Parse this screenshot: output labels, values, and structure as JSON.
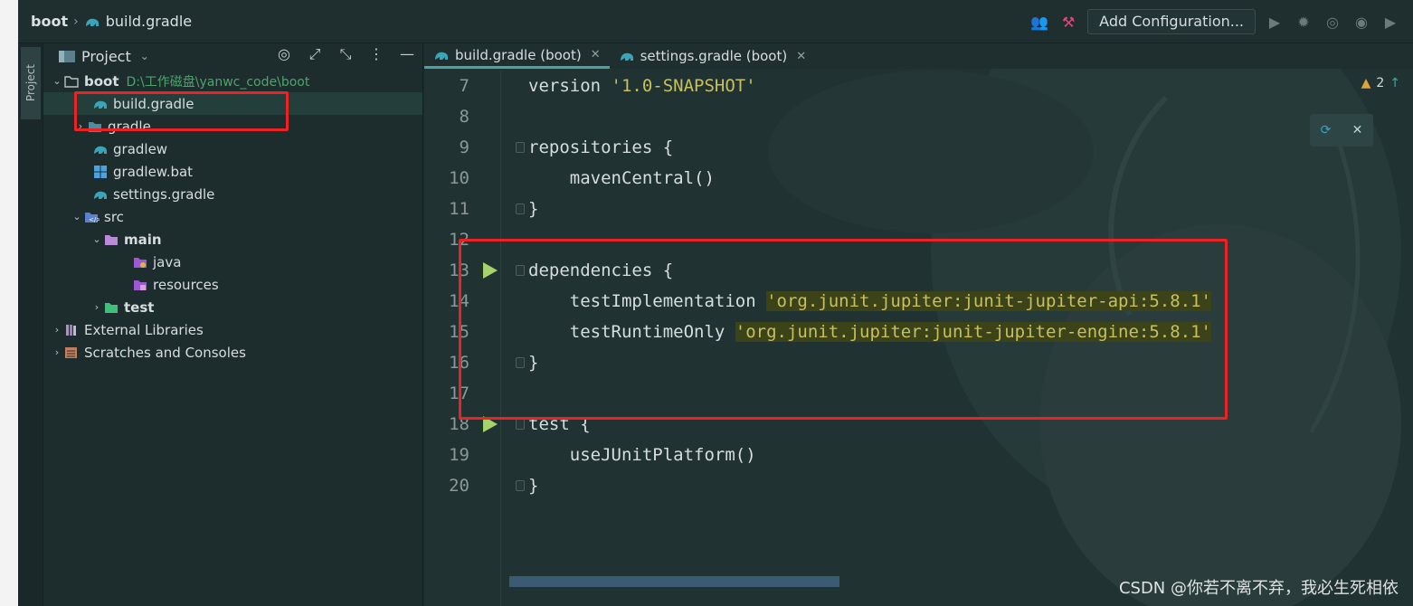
{
  "breadcrumb": {
    "root": "boot",
    "file": "build.gradle"
  },
  "toolbar": {
    "add_configuration": "Add Configuration..."
  },
  "left_stripe": {
    "label": "Project"
  },
  "project_panel": {
    "title": "Project",
    "tree": [
      {
        "label": "boot",
        "path": "D:\\工作磁盘\\yanwc_code\\boot",
        "icon": "folder-icon"
      },
      {
        "label": "build.gradle",
        "icon": "gradle-icon"
      },
      {
        "label": "gradle",
        "icon": "folder-icon"
      },
      {
        "label": "gradlew",
        "icon": "gradle-icon"
      },
      {
        "label": "gradlew.bat",
        "icon": "windows-icon"
      },
      {
        "label": "settings.gradle",
        "icon": "gradle-icon"
      },
      {
        "label": "src",
        "icon": "source-folder-icon"
      },
      {
        "label": "main",
        "icon": "folder-icon"
      },
      {
        "label": "java",
        "icon": "java-folder-icon"
      },
      {
        "label": "resources",
        "icon": "resources-folder-icon"
      },
      {
        "label": "test",
        "icon": "test-folder-icon"
      },
      {
        "label": "External Libraries",
        "icon": "library-icon"
      },
      {
        "label": "Scratches and Consoles",
        "icon": "scratches-icon"
      }
    ]
  },
  "editor": {
    "tabs": [
      {
        "label": "build.gradle (boot)"
      },
      {
        "label": "settings.gradle (boot)"
      }
    ],
    "warnings": "2",
    "lines": [
      {
        "n": "7",
        "pre": "version ",
        "str": "'1.0-SNAPSHOT'"
      },
      {
        "n": "8",
        "pre": ""
      },
      {
        "n": "9",
        "pre": "repositories {"
      },
      {
        "n": "10",
        "pre": "    mavenCentral()"
      },
      {
        "n": "11",
        "pre": "}"
      },
      {
        "n": "12",
        "pre": ""
      },
      {
        "n": "13",
        "pre": "dependencies {"
      },
      {
        "n": "14",
        "pre": "    testImplementation ",
        "str": "'org.junit.jupiter:junit-jupiter-api:5.8.1'"
      },
      {
        "n": "15",
        "pre": "    testRuntimeOnly ",
        "str": "'org.junit.jupiter:junit-jupiter-engine:5.8.1'"
      },
      {
        "n": "16",
        "pre": "}"
      },
      {
        "n": "17",
        "pre": ""
      },
      {
        "n": "18",
        "pre": "test {"
      },
      {
        "n": "19",
        "pre": "    useJUnitPlatform()"
      },
      {
        "n": "20",
        "pre": "}"
      }
    ]
  },
  "watermark": "CSDN @你若不离不弃，我必生死相依"
}
